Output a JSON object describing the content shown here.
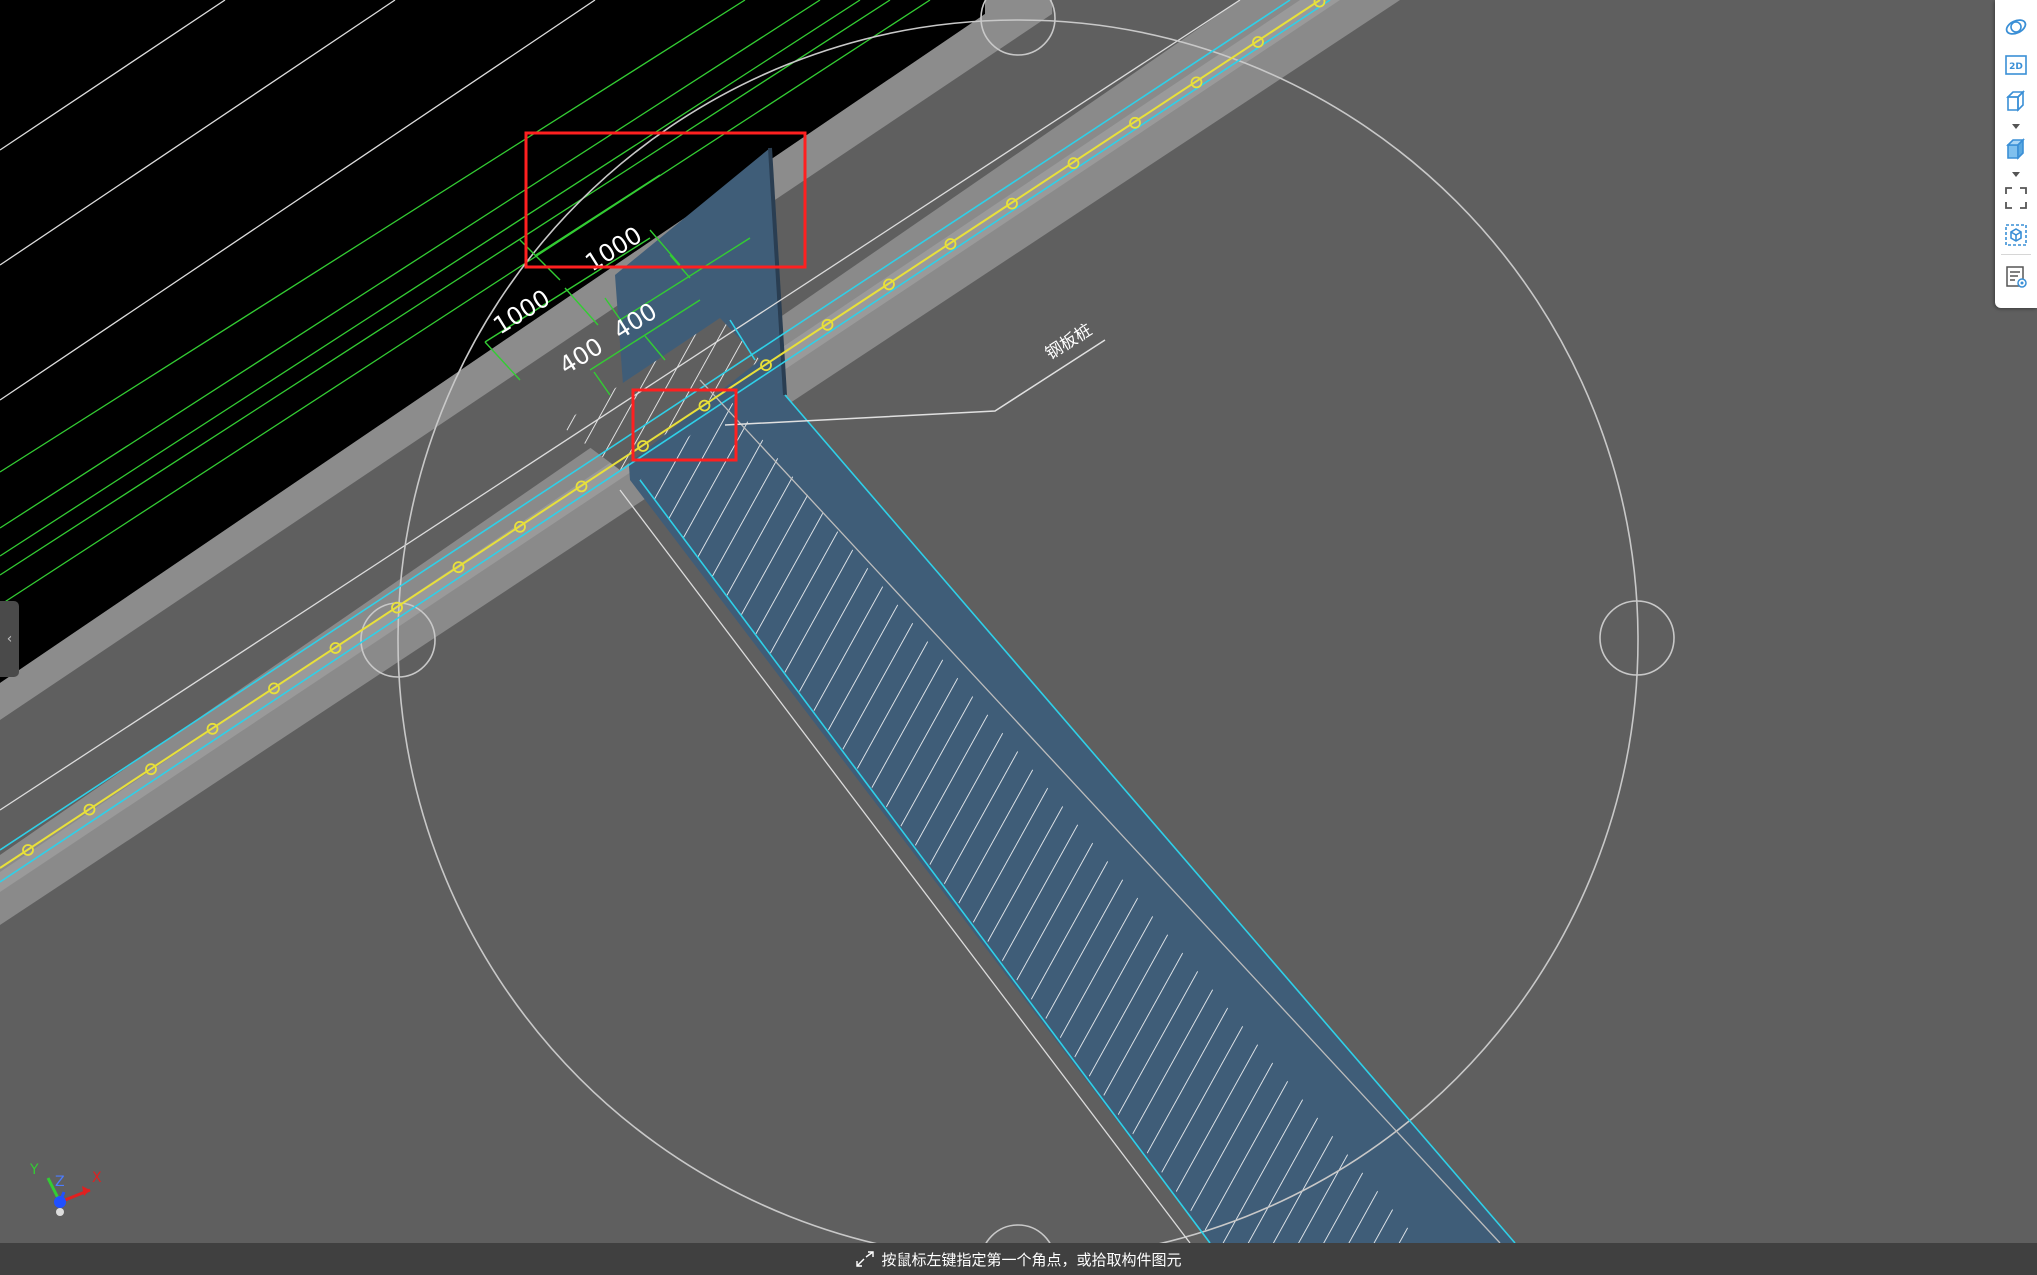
{
  "drawing": {
    "dimensions": {
      "outer_upper": "1000",
      "outer_lower": "1000",
      "inner_upper": "400",
      "inner_lower": "400"
    },
    "leader_label": "钢板桩"
  },
  "toolbar": {
    "items": [
      {
        "name": "orbit-icon"
      },
      {
        "name": "2d-view-icon",
        "label": "2D"
      },
      {
        "name": "3d-view-icon"
      },
      {
        "name": "display-mode-icon"
      },
      {
        "name": "fit-view-icon"
      },
      {
        "name": "component-view-icon"
      },
      {
        "name": "properties-icon"
      }
    ]
  },
  "status_bar": {
    "text": "按鼠标左键指定第一个角点，或拾取构件图元"
  },
  "axis": {
    "x": "X",
    "y": "Y",
    "z": "Z"
  },
  "colors": {
    "background": "#5f5f5f",
    "void": "#000000",
    "hatch_fill": "#3f5d78",
    "cyan": "#2fd0e8",
    "yellow": "#e8e03a",
    "green": "#33cc33",
    "highlight": "#ff2020"
  }
}
